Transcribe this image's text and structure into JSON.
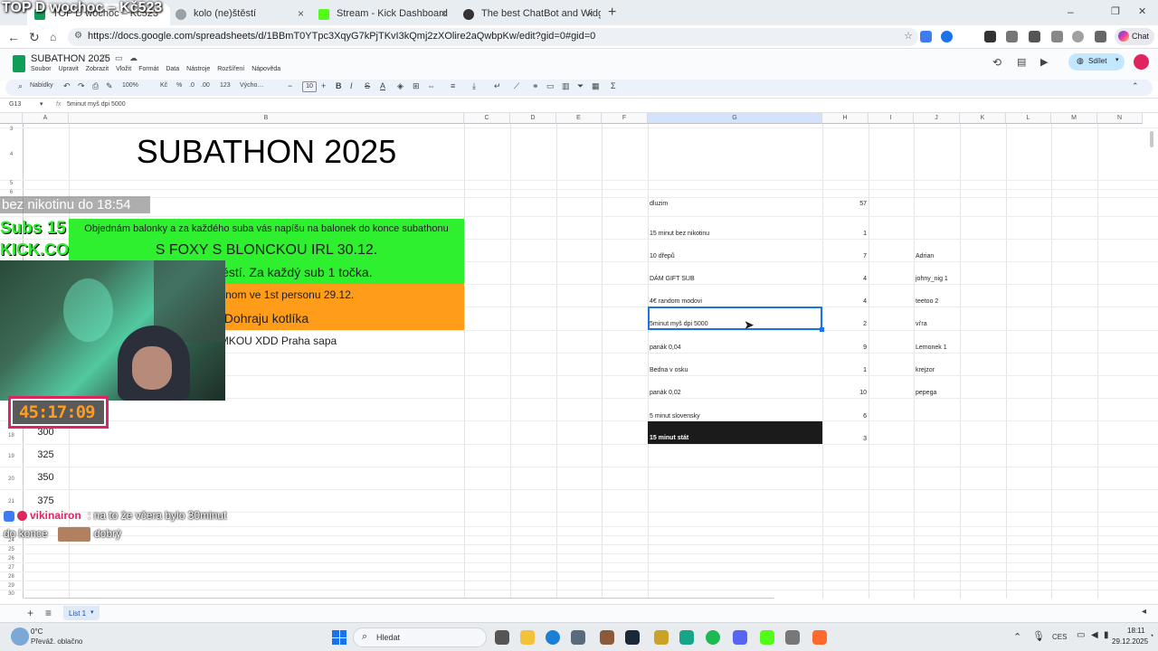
{
  "browser": {
    "tabs": [
      {
        "title": "TOP D wochoc – Kč523",
        "active": true
      },
      {
        "title": "kolo (ne)štěstí",
        "active": false
      },
      {
        "title": "Stream - Kick Dashboard",
        "active": false
      },
      {
        "title": "The best ChatBot and Widgets for",
        "active": false
      }
    ],
    "new_tab": "+",
    "url": "https://docs.google.com/spreadsheets/d/1BBmT0YTpc3XqyG7kPjTKvI3kQmj2zXOlire2aQwbpKw/edit?gid=0#gid=0",
    "chat_label": "Chat",
    "window_controls": {
      "min": "–",
      "max": "❐",
      "close": "✕"
    }
  },
  "sheets": {
    "doc_title": "SUBATHON 2025",
    "menu": [
      "Soubor",
      "Upravit",
      "Zobrazit",
      "Vložit",
      "Formát",
      "Data",
      "Nástroje",
      "Rozšíření",
      "Nápověda"
    ],
    "share_label": "Sdílet",
    "toolbar": {
      "menus_label": "Nabídky",
      "zoom": "100%",
      "currency": "Kč",
      "percent": "%",
      "dec_less": ".0",
      "dec_more": ".00",
      "format_123": "123",
      "font": "Výcho…",
      "font_size": "10",
      "bold": "B",
      "italic": "I",
      "strike": "S",
      "text_color": "A",
      "sum": "Σ"
    },
    "name_box": "G13",
    "formula": "5minut myš dpi 5000",
    "fx": "fx",
    "columns": [
      "A",
      "B",
      "C",
      "D",
      "E",
      "F",
      "G",
      "H",
      "I",
      "J",
      "K",
      "L",
      "M",
      "N"
    ],
    "row_numbers": [
      "3",
      "4",
      "5",
      "6",
      "7",
      "8",
      "9",
      "10",
      "11",
      "12",
      "13",
      "14",
      "15",
      "16",
      "17",
      "18",
      "19",
      "20",
      "21",
      "22",
      "23",
      "24",
      "25",
      "26",
      "27",
      "28",
      "29",
      "30"
    ],
    "big_title": "SUBATHON 2025",
    "col_a_values": [
      "300",
      "325",
      "350",
      "375"
    ],
    "g_items": [
      {
        "label": "dluzim",
        "value": "57",
        "name": ""
      },
      {
        "label": "15 minut bez nikotinu",
        "value": "1",
        "name": ""
      },
      {
        "label": "10 dřepů",
        "value": "7",
        "name": "Adrian"
      },
      {
        "label": "DÁM GIFT SUB",
        "value": "4",
        "name": "johny_nig 1"
      },
      {
        "label": "4€ random modovi",
        "value": "4",
        "name": "teetoo 2"
      },
      {
        "label": "5minut myš dpi 5000",
        "value": "2",
        "name": "vi'ra"
      },
      {
        "label": "panák 0,04",
        "value": "9",
        "name": "Lemonek 1"
      },
      {
        "label": "Bedna v osku",
        "value": "1",
        "name": "krejzor"
      },
      {
        "label": "panák 0,02",
        "value": "10",
        "name": "pepega"
      },
      {
        "label": "5 minut slovensky",
        "value": "6",
        "name": ""
      },
      {
        "label": "15 minut stát",
        "value": "3",
        "name": ""
      }
    ],
    "b_rows": [
      {
        "text": "Objednám balonky a za každého suba vás napíšu na balonek do konce subathonu",
        "bg": "#2ef02e"
      },
      {
        "text": "S FOXY S BLONCKOU IRL 30.12.",
        "bg": "#2ef02e"
      },
      {
        "text": "Kolo (ne)štěstí. Za každý sub 1 točka.",
        "bg": "#2ef02e"
      },
      {
        "text": "Mluvím jenom ve 1st personu 29.12.",
        "bg": "#ff9c1a"
      },
      {
        "text": "Dohraju kotlíka",
        "bg": "#ff9c1a"
      },
      {
        "text": "S LAMKOU XDD Praha sapa",
        "bg": "#ffffff"
      }
    ],
    "sheet_tab": "List 1",
    "add_sheet": "+",
    "all_sheets": "≡"
  },
  "overlay": {
    "top_title": "TOP D wochoc – Kč523",
    "nicotine": "bez nikotinu do 18:54",
    "subs_label": "Subs 15",
    "kick_label": "KICK.CO",
    "timer": "45:17:09",
    "chat_user": "vikinairon",
    "chat_message": ": na to že včera bylo 30minut",
    "chat_line2_a": "do konce",
    "chat_line2_b": "dobrý"
  },
  "taskbar": {
    "weather_temp": "0°C",
    "weather_desc": "Převáž. oblačno",
    "search_label": "Hledat",
    "lang": "CES",
    "time": "18:11",
    "date": "29.12.2025"
  },
  "colors": {
    "green": "#2ef02e",
    "orange": "#ff9c1a",
    "selection": "#1a73e8",
    "timer_border": "#e0245e"
  }
}
